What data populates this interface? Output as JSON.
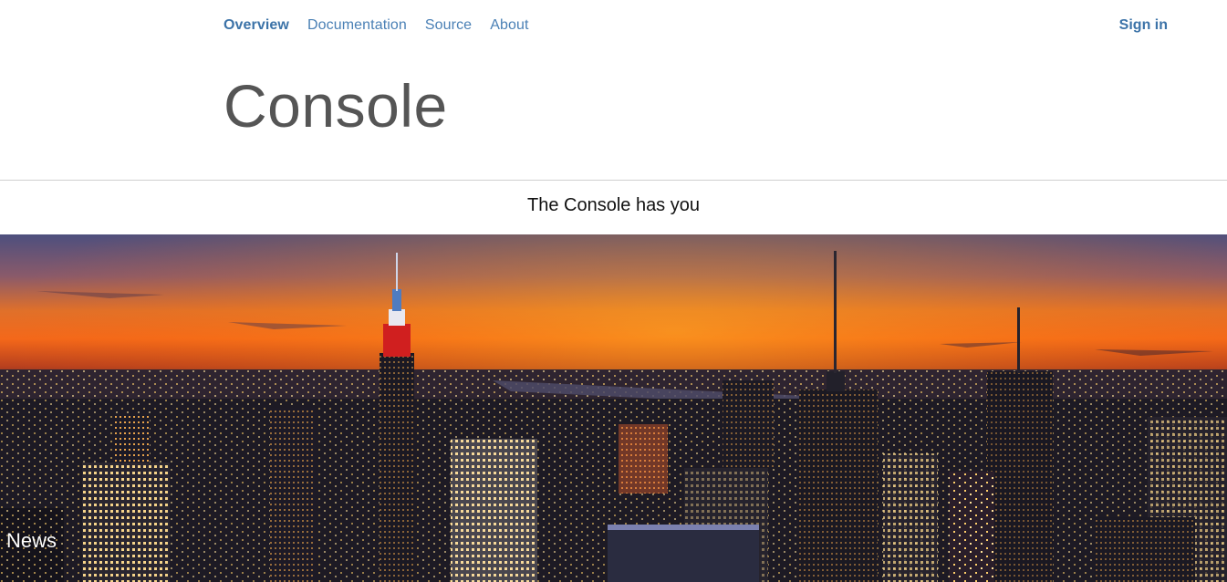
{
  "nav": {
    "items": [
      {
        "label": "Overview",
        "active": true
      },
      {
        "label": "Documentation",
        "active": false
      },
      {
        "label": "Source",
        "active": false
      },
      {
        "label": "About",
        "active": false
      }
    ],
    "signin_label": "Sign in"
  },
  "page": {
    "title": "Console",
    "tagline": "The Console has you"
  },
  "hero": {
    "caption": "News"
  },
  "colors": {
    "link": "#4a80b5",
    "link_active": "#3c73a8",
    "title": "#555555",
    "divider": "#cfcfcf"
  }
}
